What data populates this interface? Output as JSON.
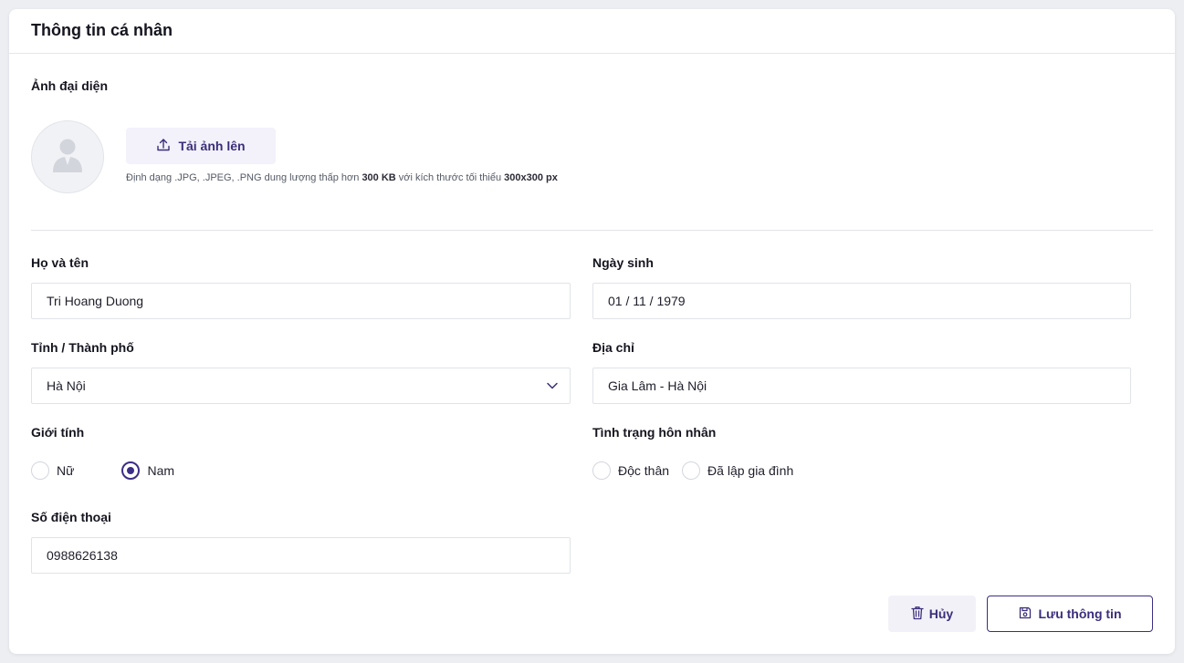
{
  "colors": {
    "accent": "#3b2e86",
    "accent_soft": "#f3f1fa",
    "border": "#e1e3e8"
  },
  "header": {
    "title": "Thông tin cá nhân"
  },
  "avatar_section": {
    "label": "Ảnh đại diện",
    "avatar_icon": "user-silhouette-icon",
    "upload_icon": "upload-icon",
    "upload_label": "Tải ảnh lên",
    "hint_prefix": "Định dạng .JPG, .JPEG, .PNG dung lượng thấp hơn ",
    "hint_size": "300 KB",
    "hint_middle": " với kích thước tối thiểu ",
    "hint_dims": "300x300 px"
  },
  "form": {
    "full_name": {
      "label": "Họ và tên",
      "value": "Tri Hoang Duong"
    },
    "birth_date": {
      "label": "Ngày sinh",
      "value": "01 / 11 / 1979"
    },
    "province": {
      "label": "Tỉnh / Thành phố",
      "value": "Hà Nội",
      "icon": "chevron-down-icon"
    },
    "address": {
      "label": "Địa chỉ",
      "value": "Gia Lâm - Hà Nội"
    },
    "gender": {
      "label": "Giới tính",
      "options": [
        "Nữ",
        "Nam"
      ],
      "selected": "Nam"
    },
    "marital_status": {
      "label": "Tình trạng hôn nhân",
      "options": [
        "Độc thân",
        "Đã lập gia đình"
      ],
      "selected": ""
    },
    "phone": {
      "label": "Số điện thoại",
      "value": "0988626138"
    }
  },
  "actions": {
    "cancel_label": "Hủy",
    "cancel_icon": "trash-icon",
    "save_label": "Lưu thông tin",
    "save_icon": "save-icon"
  }
}
